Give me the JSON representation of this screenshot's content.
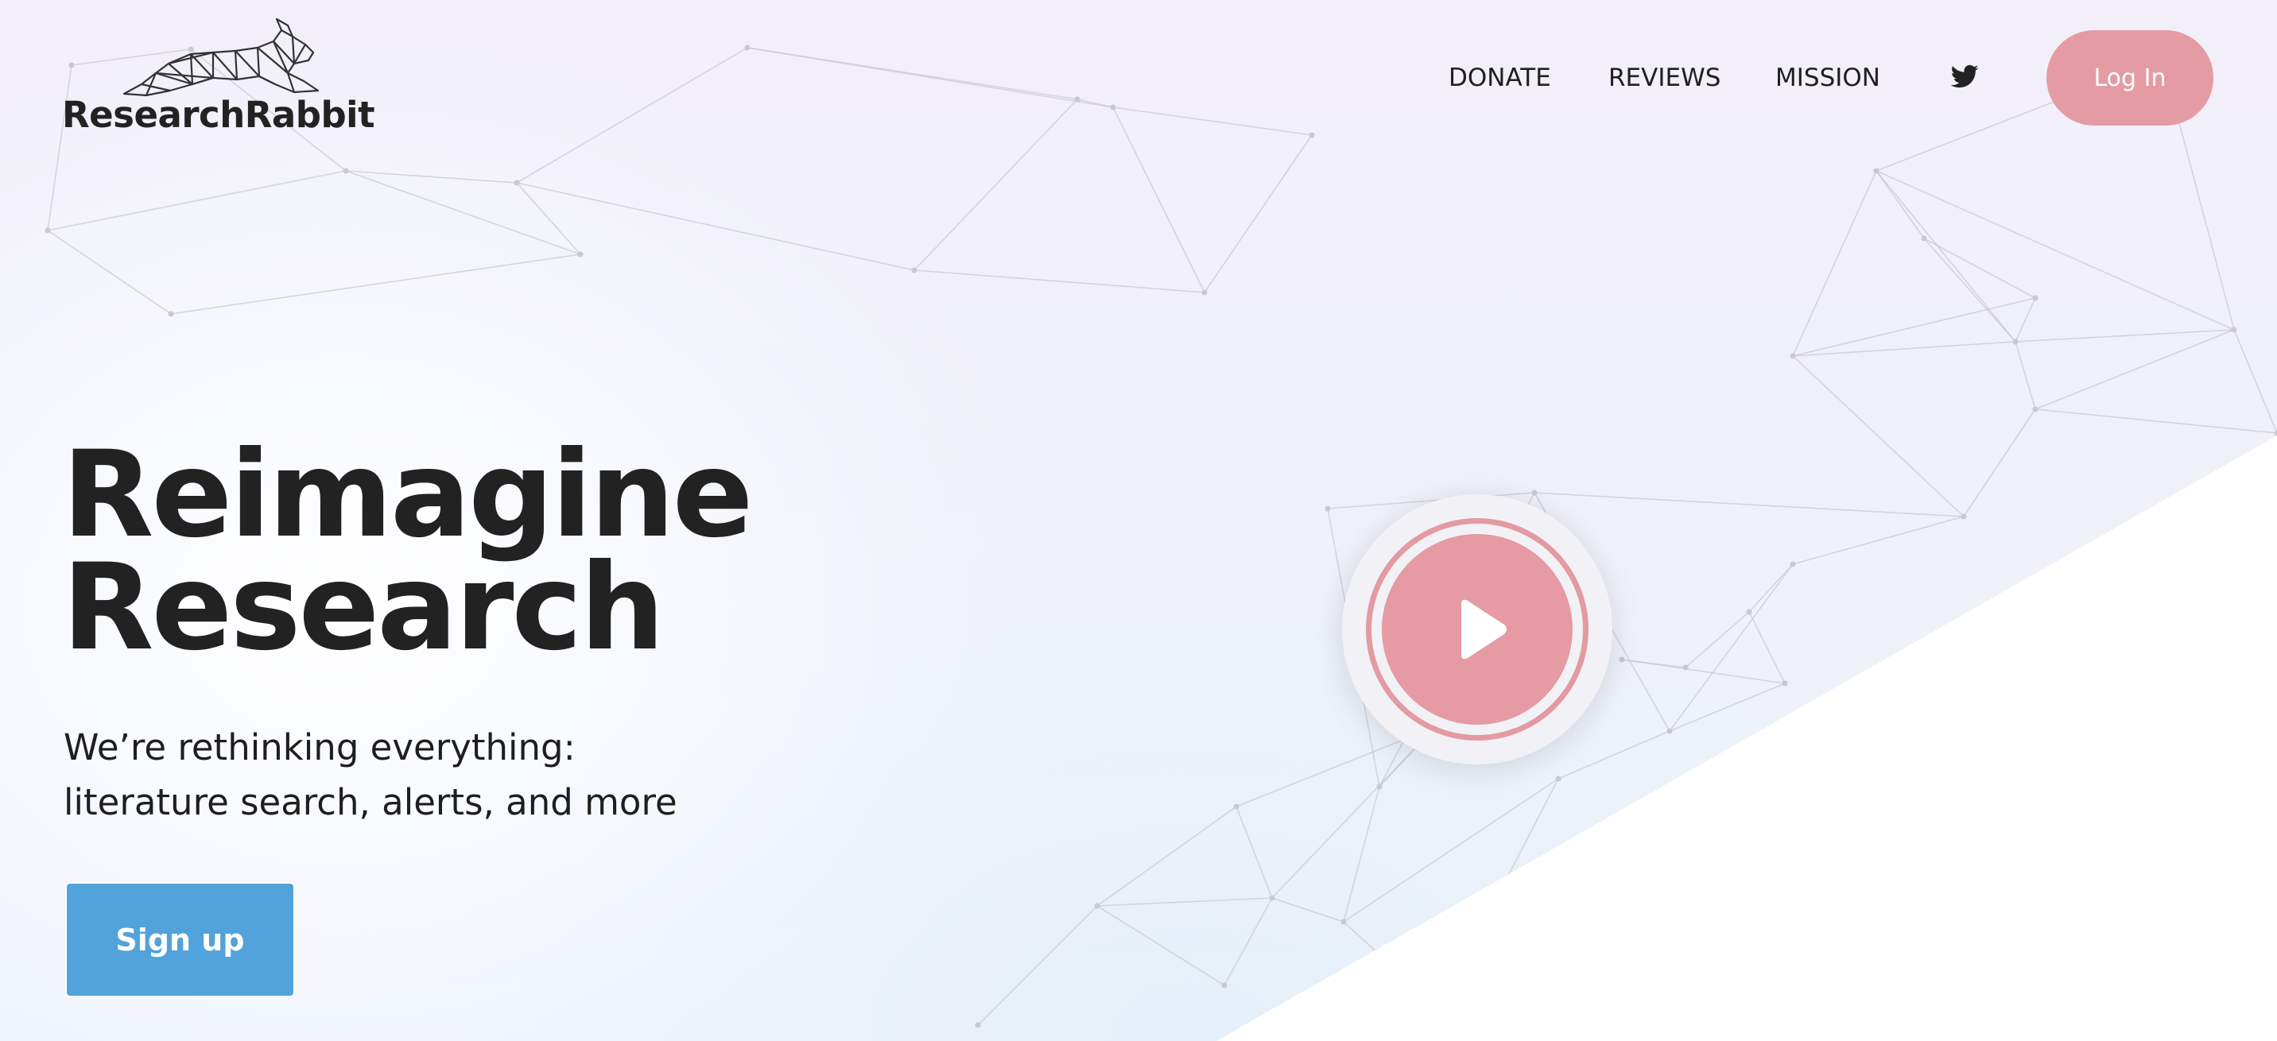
{
  "brand": {
    "name": "ResearchRabbit",
    "logo_icon": "rabbit-icon"
  },
  "nav": {
    "links": [
      {
        "label": "DONATE"
      },
      {
        "label": "REVIEWS"
      },
      {
        "label": "MISSION"
      }
    ],
    "social_icon": "twitter-icon",
    "login_label": "Log In"
  },
  "hero": {
    "title_lines": [
      "Reimagine",
      "Research"
    ],
    "subtitle_lines": [
      "We’re rethinking everything:",
      "literature search, alerts, and more"
    ],
    "signup_label": "Sign up",
    "play_icon": "play-icon"
  },
  "colors": {
    "accent_pink": "#e59ba4",
    "signup_blue": "#52a3db",
    "text_dark": "#222222",
    "network_lines": "#c9c8d2"
  }
}
